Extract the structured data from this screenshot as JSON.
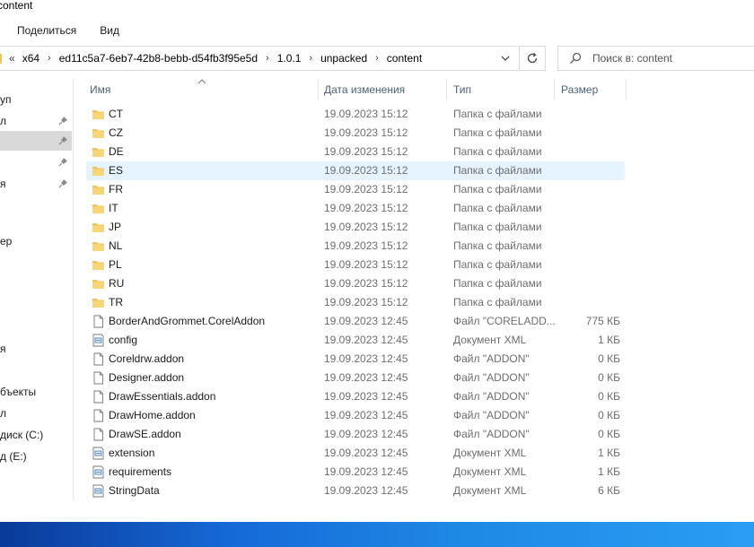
{
  "window": {
    "title": "content"
  },
  "ribbon": {
    "tabs": [
      "Поделиться",
      "Вид"
    ]
  },
  "address": {
    "overflow": "«",
    "crumbs": [
      "x64",
      "ed11c5a7-6eb7-42b8-bebb-d54fb3f95e5d",
      "1.0.1",
      "unpacked",
      "content"
    ]
  },
  "search": {
    "placeholder": "Поиск в: content"
  },
  "nav": {
    "items": [
      {
        "label": "уп",
        "pinned": false,
        "selected": false
      },
      {
        "label": "л",
        "pinned": true,
        "selected": false
      },
      {
        "label": "",
        "pinned": true,
        "selected": true
      },
      {
        "label": "",
        "pinned": true,
        "selected": false
      },
      {
        "label": "я",
        "pinned": true,
        "selected": false
      },
      {
        "label": "ер",
        "pinned": false,
        "selected": false
      },
      {
        "label": "я",
        "pinned": false,
        "selected": false
      },
      {
        "label": "бъекты",
        "pinned": false,
        "selected": false
      },
      {
        "label": "л",
        "pinned": false,
        "selected": false
      },
      {
        "label": "диск (C:)",
        "pinned": false,
        "selected": false
      },
      {
        "label": "д (E:)",
        "pinned": false,
        "selected": false
      }
    ]
  },
  "columns": {
    "name": "Имя",
    "date": "Дата изменения",
    "type": "Тип",
    "size": "Размер"
  },
  "files": [
    {
      "name": "CT",
      "date": "19.09.2023 15:12",
      "type": "Папка с файлами",
      "size": "",
      "kind": "folder"
    },
    {
      "name": "CZ",
      "date": "19.09.2023 15:12",
      "type": "Папка с файлами",
      "size": "",
      "kind": "folder"
    },
    {
      "name": "DE",
      "date": "19.09.2023 15:12",
      "type": "Папка с файлами",
      "size": "",
      "kind": "folder"
    },
    {
      "name": "ES",
      "date": "19.09.2023 15:12",
      "type": "Папка с файлами",
      "size": "",
      "kind": "folder",
      "highlight": true
    },
    {
      "name": "FR",
      "date": "19.09.2023 15:12",
      "type": "Папка с файлами",
      "size": "",
      "kind": "folder"
    },
    {
      "name": "IT",
      "date": "19.09.2023 15:12",
      "type": "Папка с файлами",
      "size": "",
      "kind": "folder"
    },
    {
      "name": "JP",
      "date": "19.09.2023 15:12",
      "type": "Папка с файлами",
      "size": "",
      "kind": "folder"
    },
    {
      "name": "NL",
      "date": "19.09.2023 15:12",
      "type": "Папка с файлами",
      "size": "",
      "kind": "folder"
    },
    {
      "name": "PL",
      "date": "19.09.2023 15:12",
      "type": "Папка с файлами",
      "size": "",
      "kind": "folder"
    },
    {
      "name": "RU",
      "date": "19.09.2023 15:12",
      "type": "Папка с файлами",
      "size": "",
      "kind": "folder"
    },
    {
      "name": "TR",
      "date": "19.09.2023 15:12",
      "type": "Папка с файлами",
      "size": "",
      "kind": "folder"
    },
    {
      "name": "BorderAndGrommet.CorelAddon",
      "date": "19.09.2023 12:45",
      "type": "Файл \"CORELADD...",
      "size": "775 КБ",
      "kind": "file"
    },
    {
      "name": "config",
      "date": "19.09.2023 12:45",
      "type": "Документ XML",
      "size": "1 КБ",
      "kind": "xml"
    },
    {
      "name": "Coreldrw.addon",
      "date": "19.09.2023 12:45",
      "type": "Файл \"ADDON\"",
      "size": "0 КБ",
      "kind": "file"
    },
    {
      "name": "Designer.addon",
      "date": "19.09.2023 12:45",
      "type": "Файл \"ADDON\"",
      "size": "0 КБ",
      "kind": "file"
    },
    {
      "name": "DrawEssentials.addon",
      "date": "19.09.2023 12:45",
      "type": "Файл \"ADDON\"",
      "size": "0 КБ",
      "kind": "file"
    },
    {
      "name": "DrawHome.addon",
      "date": "19.09.2023 12:45",
      "type": "Файл \"ADDON\"",
      "size": "0 КБ",
      "kind": "file"
    },
    {
      "name": "DrawSE.addon",
      "date": "19.09.2023 12:45",
      "type": "Файл \"ADDON\"",
      "size": "0 КБ",
      "kind": "file"
    },
    {
      "name": "extension",
      "date": "19.09.2023 12:45",
      "type": "Документ XML",
      "size": "1 КБ",
      "kind": "xml"
    },
    {
      "name": "requirements",
      "date": "19.09.2023 12:45",
      "type": "Документ XML",
      "size": "1 КБ",
      "kind": "xml"
    },
    {
      "name": "StringData",
      "date": "19.09.2023 12:45",
      "type": "Документ XML",
      "size": "6 КБ",
      "kind": "xml"
    }
  ],
  "colors": {
    "selection": "#e5f3ff",
    "folder": "#f2c55c",
    "taskbar": "#1e88e5"
  }
}
